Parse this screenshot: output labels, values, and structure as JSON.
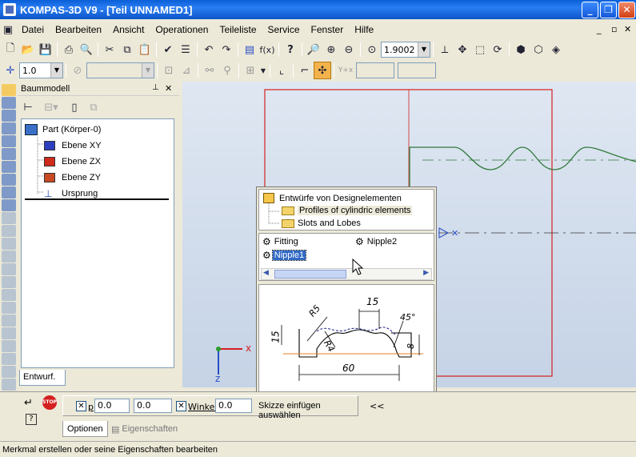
{
  "window": {
    "title": "KOMPAS-3D V9 - [Teil UNNAMED1]",
    "min": "_",
    "max": "❐",
    "close": "✕"
  },
  "menu": [
    "Datei",
    "Bearbeiten",
    "Ansicht",
    "Operationen",
    "Teileliste",
    "Service",
    "Fenster",
    "Hilfe"
  ],
  "mdi": {
    "min": "_",
    "restore": "▫",
    "close": "✕"
  },
  "toolbar": {
    "zoom_value": "1.9002",
    "scale_value": "1.0"
  },
  "tree": {
    "title": "Baummodell",
    "pin": "📌",
    "close": "✕",
    "items": [
      {
        "label": "Part (Körper-0)",
        "color": "#3a6fc8"
      },
      {
        "label": "Ebene XY",
        "color": "#2b3fc0"
      },
      {
        "label": "Ebene ZX",
        "color": "#d02a1a"
      },
      {
        "label": "Ebene ZY",
        "color": "#c84a22"
      },
      {
        "label": "Ursprung",
        "color": "#2a4cc4"
      }
    ],
    "bottom_tab": "Entwurf."
  },
  "library": {
    "root": "Entwürfe von Designelementen",
    "folders": [
      "Profiles of cylindric elements",
      "Slots and Lobes"
    ],
    "items": [
      "Fitting",
      "Nipple2",
      "Nipple1"
    ],
    "selected": "Nipple1",
    "preview": {
      "dim_top": "15",
      "dim_left": "15",
      "dim_r": "R5",
      "dim_r4": "R4",
      "dim_angle": "45°",
      "dim_right": "8",
      "dim_bottom": "60"
    }
  },
  "axes": {
    "x": "x",
    "z": "z"
  },
  "bottom": {
    "p_label": "p",
    "p1": "0.0",
    "p2": "0.0",
    "winkel_label": "Winkel",
    "winkel": "0.0",
    "action": "Skizze einfügen auswählen",
    "collapse": "<<",
    "tab_optionen": "Optionen",
    "tab_eigenschaften": "Eigenschaften"
  },
  "status": "Merkmal erstellen oder seine Eigenschaften bearbeiten",
  "colors": {
    "titlebar": "#0a55c8",
    "panel": "#ece9d8",
    "viewport": "#cdd9ea",
    "frame": "#d42020",
    "curve": "#2f7a3a"
  }
}
